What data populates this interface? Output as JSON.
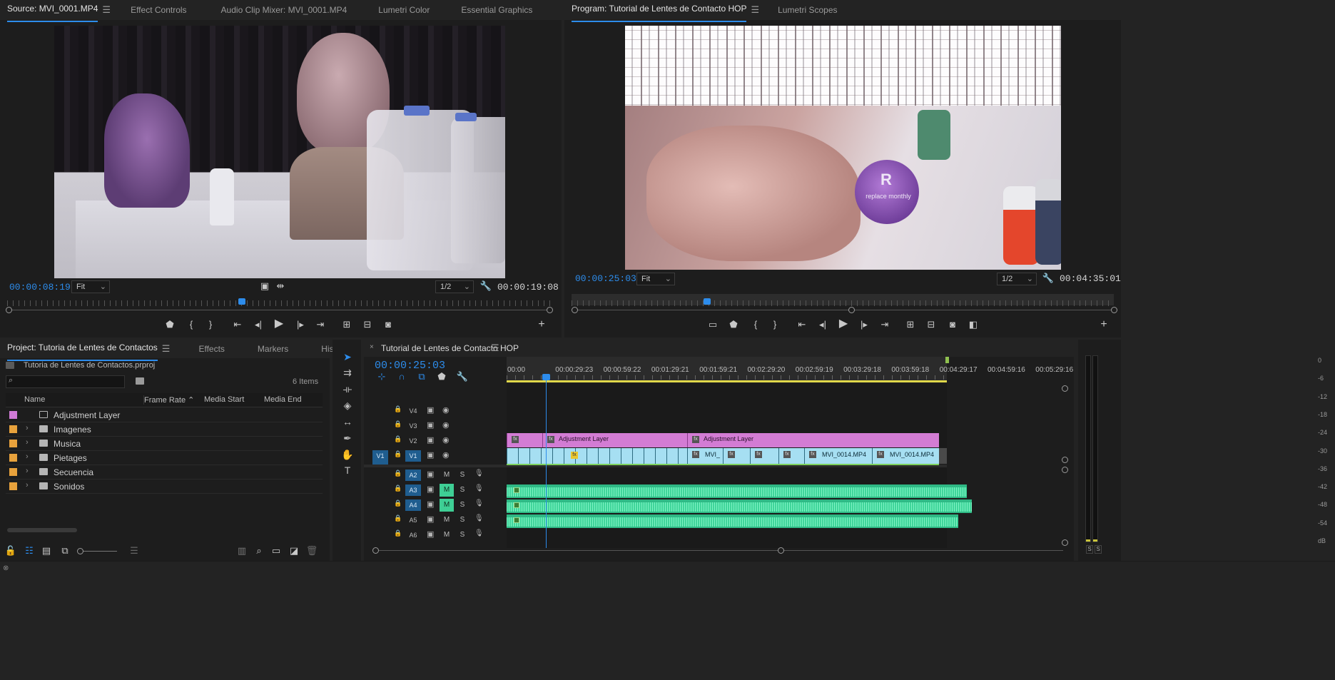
{
  "source_monitor": {
    "tabs": [
      {
        "label": "Source: MVI_0001.MP4",
        "active": true
      },
      {
        "label": "Effect Controls"
      },
      {
        "label": "Audio Clip Mixer: MVI_0001.MP4"
      },
      {
        "label": "Lumetri Color"
      },
      {
        "label": "Essential Graphics"
      }
    ],
    "timecode_current": "00:00:08:19",
    "zoom": "Fit",
    "resolution": "1/2",
    "duration": "00:00:19:08",
    "playhead_fraction": 0.43
  },
  "program_monitor": {
    "tabs": [
      {
        "label": "Program: Tutorial de Lentes de Contacto HOP",
        "active": true
      },
      {
        "label": "Lumetri Scopes"
      }
    ],
    "timecode_current": "00:00:25:03",
    "zoom": "Fit",
    "resolution": "1/2",
    "duration": "00:04:35:01",
    "playhead_fraction": 0.25,
    "label_text": "replace monthly",
    "label_letter": "R"
  },
  "project_panel": {
    "tabs": [
      {
        "label": "Project: Tutoria de Lentes de Contactos",
        "active": true
      },
      {
        "label": "Effects"
      },
      {
        "label": "Markers"
      },
      {
        "label": "History"
      }
    ],
    "file_name": "Tutoria de Lentes de Contactos.prproj",
    "items_count": "6 Items",
    "search_placeholder": "",
    "columns": [
      "Name",
      "Frame Rate",
      "Media Start",
      "Media End"
    ],
    "items": [
      {
        "name": "Adjustment Layer",
        "color": "#d07ad6",
        "type": "file"
      },
      {
        "name": "Imagenes",
        "color": "#e8a23c",
        "type": "folder"
      },
      {
        "name": "Musica",
        "color": "#e8a23c",
        "type": "folder"
      },
      {
        "name": "Pietages",
        "color": "#e8a23c",
        "type": "folder"
      },
      {
        "name": "Secuencia",
        "color": "#e8a23c",
        "type": "folder"
      },
      {
        "name": "Sonidos",
        "color": "#e8a23c",
        "type": "folder"
      }
    ]
  },
  "timeline": {
    "tab": "Tutorial de Lentes de Contacto HOP",
    "timecode": "00:00:25:03",
    "ruler_labels": [
      "00:00",
      "00:00:29:23",
      "00:00:59:22",
      "00:01:29:21",
      "00:01:59:21",
      "00:02:29:20",
      "00:02:59:19",
      "00:03:29:18",
      "00:03:59:18",
      "00:04:29:17",
      "00:04:59:16",
      "00:05:29:16"
    ],
    "video_tracks": [
      "V4",
      "V3",
      "V2",
      "V1"
    ],
    "source_patch": "V1",
    "audio_tracks": [
      {
        "name": "A2",
        "sel": true,
        "m_on": false
      },
      {
        "name": "A3",
        "sel": true,
        "m_on": true
      },
      {
        "name": "A4",
        "sel": true,
        "m_on": true
      },
      {
        "name": "A5",
        "sel": false,
        "m_on": false
      },
      {
        "name": "A6",
        "sel": false,
        "m_on": false
      }
    ],
    "m_label": "M",
    "s_label": "S",
    "adjustment_clip_1": "Adjustment Layer",
    "adjustment_clip_2": "Adjustment Layer",
    "v1_clip_labels": [
      "MVI_",
      "MVI_0014.MP4",
      "MVI_0014.MP4"
    ],
    "fx_label": "fx"
  },
  "audio_meter": {
    "scale": [
      "0",
      "-6",
      "-12",
      "-18",
      "-24",
      "-30",
      "-36",
      "-42",
      "-48",
      "-54",
      "dB"
    ],
    "solo_labels": [
      "S",
      "S"
    ]
  }
}
